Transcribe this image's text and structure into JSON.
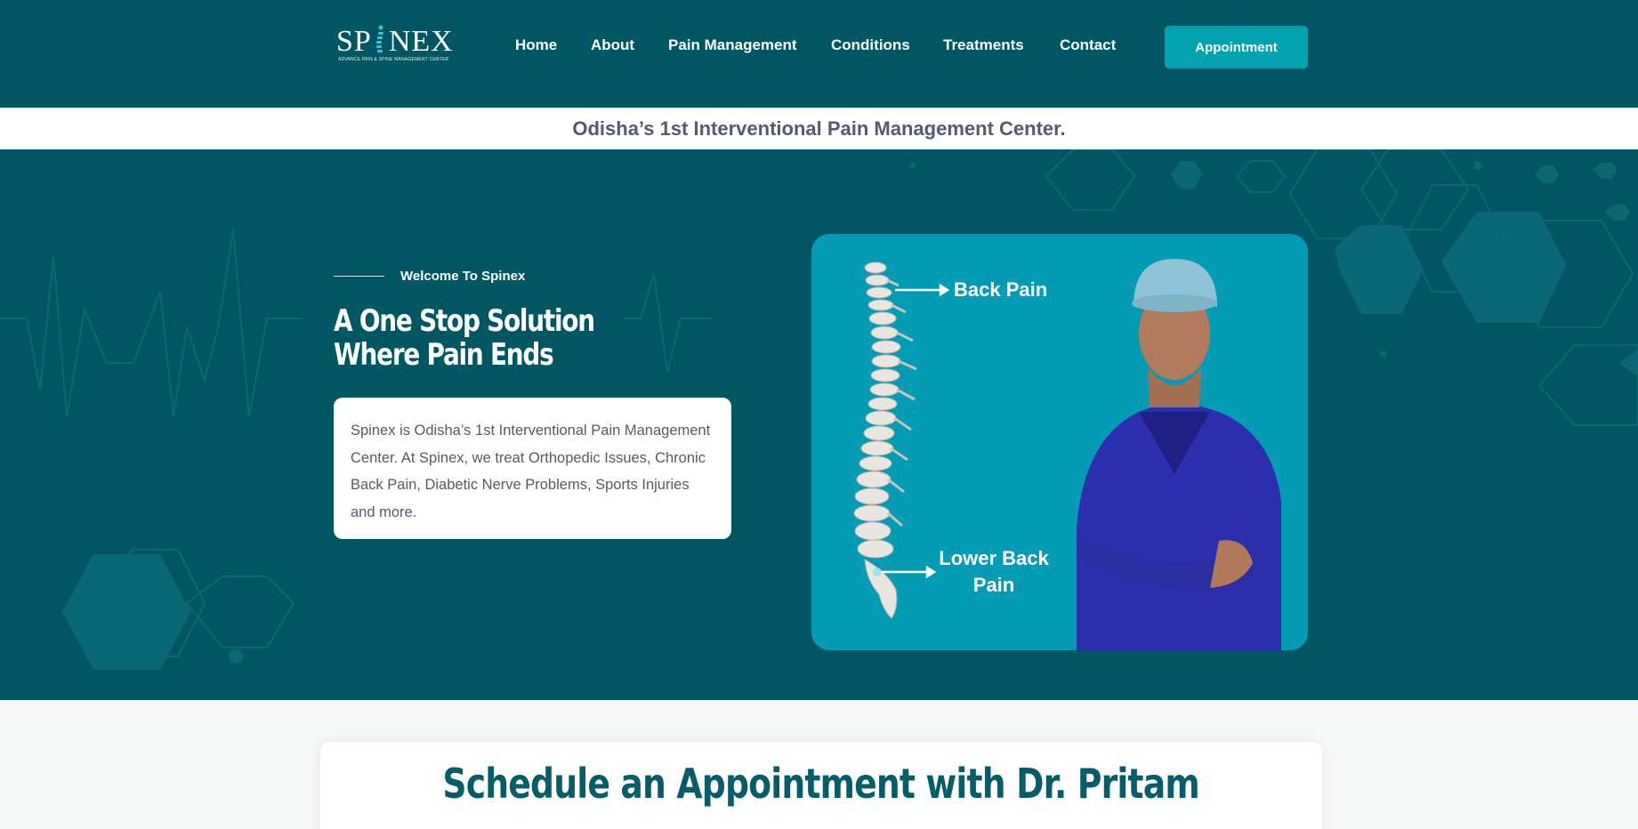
{
  "brand": {
    "name": "SP NEX",
    "subtitle": "ADVANCE PAIN & SPINE MANAGEMENT CENTER"
  },
  "nav": {
    "items": [
      "Home",
      "About",
      "Pain Management",
      "Conditions",
      "Treatments",
      "Contact"
    ],
    "cta": "Appointment"
  },
  "tagline": "Odisha’s 1st Interventional Pain Management Center.",
  "hero": {
    "eyebrow": "Welcome To Spinex",
    "title": "A One Stop Solution Where Pain Ends",
    "description": "Spinex is Odisha’s 1st Interventional Pain Management Center. At Spinex, we treat Orthopedic Issues, Chronic Back Pain, Diabetic Nerve Problems, Sports Injuries and more.",
    "image_labels": {
      "upper": "Back Pain",
      "lower": "Lower Back Pain"
    }
  },
  "appointment": {
    "title": "Schedule an Appointment with Dr. Pritam"
  },
  "colors": {
    "header_bg": "#005763",
    "hero_bg": "#005763",
    "accent": "#00a2ae",
    "image_panel": "#039cb4",
    "tagline_text": "#545a73",
    "appointment_title": "#045e6a"
  },
  "icons": [
    "spine-logo-icon",
    "arrow-right-icon",
    "spine-illustration",
    "doctor-photo"
  ]
}
